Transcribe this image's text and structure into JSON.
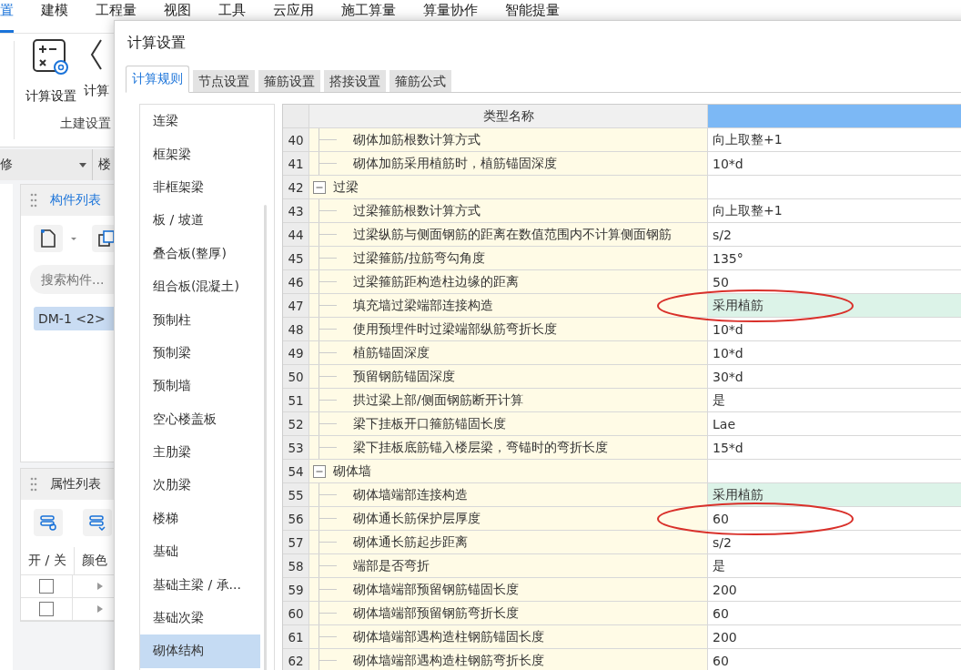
{
  "menu": [
    {
      "label": "置",
      "selected": true
    },
    {
      "label": "建模",
      "selected": false
    },
    {
      "label": "工程量",
      "selected": false
    },
    {
      "label": "视图",
      "selected": false
    },
    {
      "label": "工具",
      "selected": false
    },
    {
      "label": "云应用",
      "selected": false
    },
    {
      "label": "施工算量",
      "selected": false
    },
    {
      "label": "算量协作",
      "selected": false
    },
    {
      "label": "智能提量",
      "selected": false
    }
  ],
  "ribbon": {
    "buttons": [
      "计算设置",
      "计算"
    ],
    "group_label": "土建设置"
  },
  "floor_bar": {
    "dropdown": "修",
    "next": "楼"
  },
  "component_panel": {
    "title": "构件列表",
    "search": {
      "placeholder": "搜索构件..."
    },
    "items": [
      {
        "label": "DM-1 <2>",
        "selected": true
      }
    ]
  },
  "property_panel": {
    "title": "属性列表",
    "columns": [
      "开 / 关",
      "颜色"
    ],
    "rows": [
      {
        "checked": false
      },
      {
        "checked": false
      }
    ]
  },
  "dialog": {
    "title": "计算设置",
    "tabs": [
      {
        "label": "计算规则",
        "selected": true
      },
      {
        "label": "节点设置",
        "selected": false
      },
      {
        "label": "箍筋设置",
        "selected": false
      },
      {
        "label": "搭接设置",
        "selected": false
      },
      {
        "label": "箍筋公式",
        "selected": false
      }
    ],
    "categories": [
      {
        "label": "连梁",
        "selected": false
      },
      {
        "label": "框架梁",
        "selected": false
      },
      {
        "label": "非框架梁",
        "selected": false
      },
      {
        "label": "板 / 坡道",
        "selected": false
      },
      {
        "label": "叠合板(整厚)",
        "selected": false
      },
      {
        "label": "组合板(混凝土)",
        "selected": false
      },
      {
        "label": "预制柱",
        "selected": false
      },
      {
        "label": "预制梁",
        "selected": false
      },
      {
        "label": "预制墙",
        "selected": false
      },
      {
        "label": "空心楼盖板",
        "selected": false
      },
      {
        "label": "主肋梁",
        "selected": false
      },
      {
        "label": "次肋梁",
        "selected": false
      },
      {
        "label": "楼梯",
        "selected": false
      },
      {
        "label": "基础",
        "selected": false
      },
      {
        "label": "基础主梁 / 承...",
        "selected": false
      },
      {
        "label": "基础次梁",
        "selected": false
      },
      {
        "label": "砌体结构",
        "selected": true
      }
    ],
    "table": {
      "columns": [
        "类型名称"
      ],
      "rows": [
        {
          "num": "40",
          "kind": "item",
          "name": "砌体加筋根数计算方式",
          "value": "向上取整+1",
          "modified": false,
          "circled": false
        },
        {
          "num": "41",
          "kind": "item",
          "name": "砌体加筋采用植筋时，植筋锚固深度",
          "value": "10*d",
          "modified": false,
          "circled": false
        },
        {
          "num": "42",
          "kind": "group",
          "name": "过梁",
          "expanded": true
        },
        {
          "num": "43",
          "kind": "item",
          "name": "过梁箍筋根数计算方式",
          "value": "向上取整+1",
          "modified": false,
          "circled": false
        },
        {
          "num": "44",
          "kind": "item",
          "name": "过梁纵筋与侧面钢筋的距离在数值范围内不计算侧面钢筋",
          "value": "s/2",
          "modified": false,
          "circled": false
        },
        {
          "num": "45",
          "kind": "item",
          "name": "过梁箍筋/拉筋弯勾角度",
          "value": "135°",
          "modified": false,
          "circled": false
        },
        {
          "num": "46",
          "kind": "item",
          "name": "过梁箍筋距构造柱边缘的距离",
          "value": "50",
          "modified": false,
          "circled": false
        },
        {
          "num": "47",
          "kind": "item",
          "name": "填充墙过梁端部连接构造",
          "value": "采用植筋",
          "modified": true,
          "circled": true
        },
        {
          "num": "48",
          "kind": "item",
          "name": "使用预埋件时过梁端部纵筋弯折长度",
          "value": "10*d",
          "modified": false,
          "circled": false
        },
        {
          "num": "49",
          "kind": "item",
          "name": "植筋锚固深度",
          "value": "10*d",
          "modified": false,
          "circled": false
        },
        {
          "num": "50",
          "kind": "item",
          "name": "预留钢筋锚固深度",
          "value": "30*d",
          "modified": false,
          "circled": false
        },
        {
          "num": "51",
          "kind": "item",
          "name": "拱过梁上部/侧面钢筋断开计算",
          "value": "是",
          "modified": false,
          "circled": false
        },
        {
          "num": "52",
          "kind": "item",
          "name": "梁下挂板开口箍筋锚固长度",
          "value": "Lae",
          "modified": false,
          "circled": false
        },
        {
          "num": "53",
          "kind": "item",
          "name": "梁下挂板底筋锚入楼层梁，弯锚时的弯折长度",
          "value": "15*d",
          "modified": false,
          "circled": false
        },
        {
          "num": "54",
          "kind": "group",
          "name": "砌体墙",
          "expanded": true
        },
        {
          "num": "55",
          "kind": "item",
          "name": "砌体墙端部连接构造",
          "value": "采用植筋",
          "modified": true,
          "circled": false
        },
        {
          "num": "56",
          "kind": "item",
          "name": "砌体通长筋保护层厚度",
          "value": "60",
          "modified": false,
          "circled": true
        },
        {
          "num": "57",
          "kind": "item",
          "name": "砌体通长筋起步距离",
          "value": "s/2",
          "modified": false,
          "circled": false
        },
        {
          "num": "58",
          "kind": "item",
          "name": "端部是否弯折",
          "value": "是",
          "modified": false,
          "circled": false
        },
        {
          "num": "59",
          "kind": "item",
          "name": "砌体墙端部预留钢筋锚固长度",
          "value": "200",
          "modified": false,
          "circled": false
        },
        {
          "num": "60",
          "kind": "item",
          "name": "砌体墙端部预留钢筋弯折长度",
          "value": "60",
          "modified": false,
          "circled": false
        },
        {
          "num": "61",
          "kind": "item",
          "name": "砌体墙端部遇构造柱钢筋锚固长度",
          "value": "200",
          "modified": false,
          "circled": false
        },
        {
          "num": "62",
          "kind": "item",
          "name": "砌体墙端部遇构造柱钢筋弯折长度",
          "value": "60",
          "modified": false,
          "circled": false
        }
      ]
    }
  }
}
